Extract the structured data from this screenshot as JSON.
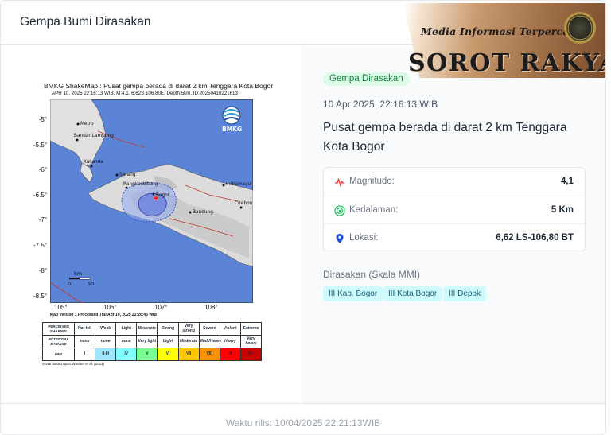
{
  "header": {
    "title": "Gempa Bumi Dirasakan"
  },
  "brand": {
    "tagline": "Media Informasi Terpercaya",
    "name": "SOROT RAKYAT"
  },
  "shakemap": {
    "title": "BMKG ShakeMap : Pusat gempa berada di darat 2 km Tenggara Kota Bogor",
    "subtitle": "APR 10, 2025 22:16:13 WIB, M:4.1, 6.62S 106.80E, Depth:5km, ID:20250410221613",
    "logo_text": "BMKG",
    "y_ticks": [
      "-5°",
      "-5.5°",
      "-6°",
      "-6.5°",
      "-7°",
      "-7.5°",
      "-8°",
      "-8.5°"
    ],
    "x_ticks": [
      "105°",
      "106°",
      "107°",
      "108°"
    ],
    "places": [
      "Metro",
      "Bandar Lampung",
      "Kalianda",
      "Serang",
      "Rangkasbitung",
      "Bogor",
      "Indramayu",
      "Bandung",
      "Cirebon"
    ],
    "scale_unit": "km",
    "scale_ticks": [
      "0",
      "50"
    ],
    "processed": "Map Version 1 Processed Thu Apr 10, 2025 22:20:45 WIB",
    "note": "Scale based upon Worden et al. (2011)",
    "colors": {
      "sea": "#5b84d6",
      "land": "#dcdcdc"
    },
    "table": {
      "row_heads": [
        "PERCEIVED SHAKING",
        "POTENTIAL DAMAGE",
        "MMI"
      ],
      "shaking": [
        "Not felt",
        "Weak",
        "Light",
        "Moderate",
        "Strong",
        "Very strong",
        "Severe",
        "Violent",
        "Extreme"
      ],
      "damage": [
        "none",
        "none",
        "none",
        "Very light",
        "Light",
        "Moderate",
        "Mod./Heavy",
        "Heavy",
        "Very heavy"
      ],
      "mmi": [
        "I",
        "II-III",
        "IV",
        "V",
        "VI",
        "VII",
        "VIII",
        "IX",
        "X+"
      ],
      "mmi_colors": [
        "#ffffff",
        "#bfccff",
        "#a0e6ff",
        "#80ffff",
        "#7aff93",
        "#ffff00",
        "#ffc800",
        "#ff9100",
        "#ff0000",
        "#c80000"
      ]
    }
  },
  "event": {
    "badge": "Gempa Dirasakan",
    "datetime": "10 Apr 2025, 22:16:13 WIB",
    "headline": "Pusat gempa berada di darat 2 km Tenggara Kota Bogor",
    "rows": [
      {
        "icon": "pulse-icon",
        "label": "Magnitudo:",
        "value": "4,1",
        "color": "#ef4444"
      },
      {
        "icon": "target-icon",
        "label": "Kedalaman:",
        "value": "5 Km",
        "color": "#22c55e"
      },
      {
        "icon": "location-pin-icon",
        "label": "Lokasi:",
        "value": "6,62 LS-106,80 BT",
        "color": "#1d4ed8"
      }
    ],
    "felt_title": "Dirasakan (Skala MMI)",
    "felt": [
      "III Kab. Bogor",
      "III Kota Bogor",
      "III Depok"
    ]
  },
  "footer": {
    "release": "Waktu rilis: 10/04/2025 22:21:13WIB"
  }
}
